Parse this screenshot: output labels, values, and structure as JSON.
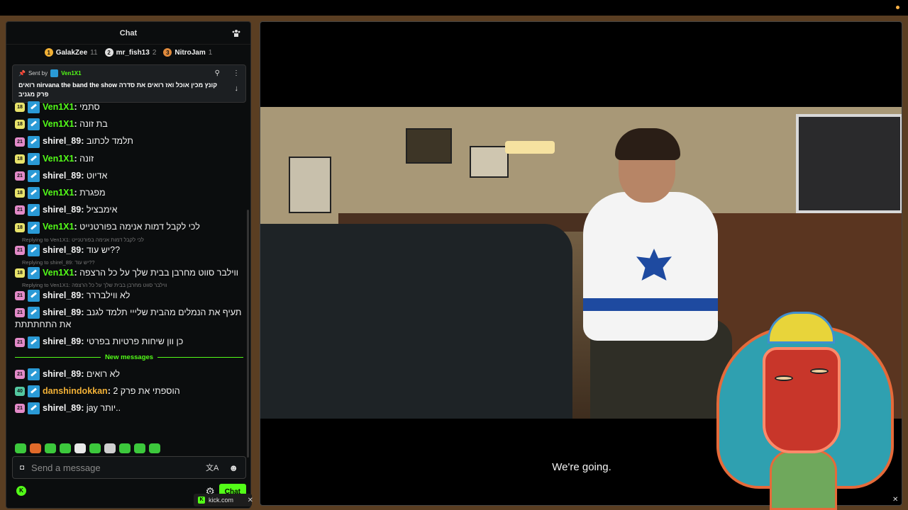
{
  "chat": {
    "title": "Chat",
    "leaderboard": [
      {
        "rank": "1",
        "name": "GalakZee",
        "count": "11",
        "color": "#f2b136"
      },
      {
        "rank": "2",
        "name": "mr_fish13",
        "count": "2",
        "color": "#e0e0e0"
      },
      {
        "rank": "3",
        "name": "NitroJam",
        "count": "1",
        "color": "#e08a3c"
      }
    ],
    "pinned": {
      "sent_by_label": "Sent by",
      "user": "Ven1X1",
      "text": "קונץ מכין אוכל ואז רואים את סדרה nirvana the band the show רואים פרק מגניב"
    },
    "messages": [
      {
        "age": "18",
        "age_color": "#e8e36a",
        "user": "Ven1X1",
        "user_color": "#53fc18",
        "text": "סתמי"
      },
      {
        "age": "18",
        "age_color": "#e8e36a",
        "user": "Ven1X1",
        "user_color": "#53fc18",
        "text": "בת זונה"
      },
      {
        "age": "21",
        "age_color": "#e38ac8",
        "user": "shirel_89",
        "user_color": "#f2f2f2",
        "text": "תלמד לכתוב"
      },
      {
        "age": "18",
        "age_color": "#e8e36a",
        "user": "Ven1X1",
        "user_color": "#53fc18",
        "text": "זונה"
      },
      {
        "age": "21",
        "age_color": "#e38ac8",
        "user": "shirel_89",
        "user_color": "#f2f2f2",
        "text": "אדיוט"
      },
      {
        "age": "18",
        "age_color": "#e8e36a",
        "user": "Ven1X1",
        "user_color": "#53fc18",
        "text": "מפגרת"
      },
      {
        "age": "21",
        "age_color": "#e38ac8",
        "user": "shirel_89",
        "user_color": "#f2f2f2",
        "text": "אימבציל"
      },
      {
        "age": "18",
        "age_color": "#e8e36a",
        "user": "Ven1X1",
        "user_color": "#53fc18",
        "text": "לכי לקבל דמות אנימה בפורטנייט"
      },
      {
        "reply": "Replying to Ven1X1: לכי לקבל דמות אנימה בפורטנייט",
        "age": "21",
        "age_color": "#e38ac8",
        "user": "shirel_89",
        "user_color": "#f2f2f2",
        "text": "יש עוד??"
      },
      {
        "reply": "Replying to shirel_89: יש עוד??",
        "age": "18",
        "age_color": "#e8e36a",
        "user": "Ven1X1",
        "user_color": "#53fc18",
        "text": "ווילבר סווט מחרבן בבית שלך על כל הרצפה"
      },
      {
        "reply": "Replying to Ven1X1: ווילבר סווט מחרבן בבית שלך על כל הרצפה",
        "age": "21",
        "age_color": "#e38ac8",
        "user": "shirel_89",
        "user_color": "#f2f2f2",
        "text": "לא ווילבררר"
      },
      {
        "age": "21",
        "age_color": "#e38ac8",
        "user": "shirel_89",
        "user_color": "#f2f2f2",
        "text": "תעיף את הנמלים מהבית שלייי תלמד לגנב את התחתתתת"
      },
      {
        "age": "21",
        "age_color": "#e38ac8",
        "user": "shirel_89",
        "user_color": "#f2f2f2",
        "text": "כן וון שיחות פרטיות בפרטי"
      }
    ],
    "new_messages_label": "New messages",
    "new_messages": [
      {
        "age": "21",
        "age_color": "#e38ac8",
        "user": "shirel_89",
        "user_color": "#f2f2f2",
        "text": "לא רואים"
      },
      {
        "age": "40",
        "age_color": "#53c8a0",
        "user": "danshindokkan",
        "user_color": "#f2b136",
        "text": "הוספתי את פרק 2"
      },
      {
        "age": "21",
        "age_color": "#e38ac8",
        "user": "shirel_89",
        "user_color": "#f2f2f2",
        "text": "jay יותר.."
      }
    ],
    "input_placeholder": "Send a message",
    "send_label": "Chat"
  },
  "video": {
    "subtitle": "We're going."
  },
  "browser": {
    "url": "kick.com"
  }
}
